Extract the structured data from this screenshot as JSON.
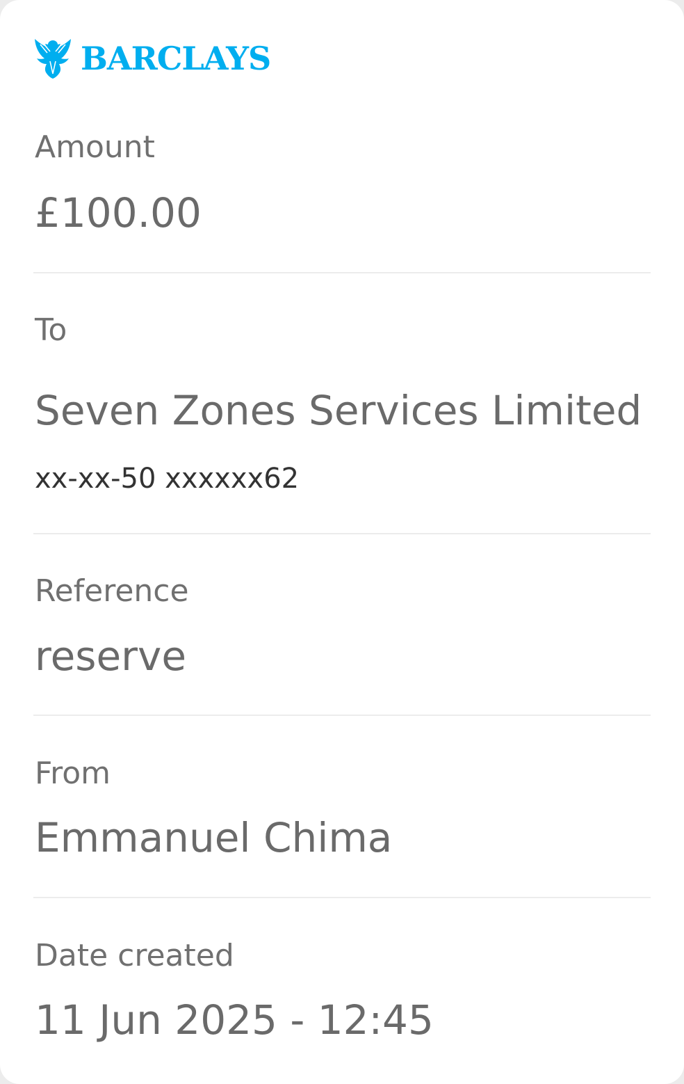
{
  "brand": {
    "name": "BARCLAYS",
    "logo_icon": "eagle-icon",
    "color": "#00aeef"
  },
  "amount": {
    "label": "Amount",
    "value": "£100.00"
  },
  "to": {
    "label": "To",
    "name": "Seven Zones Services Limited",
    "account": "xx-xx-50 xxxxxx62"
  },
  "reference": {
    "label": "Reference",
    "value": "reserve"
  },
  "from": {
    "label": "From",
    "value": "Emmanuel Chima"
  },
  "date_created": {
    "label": "Date created",
    "value": "11 Jun 2025 - 12:45"
  }
}
